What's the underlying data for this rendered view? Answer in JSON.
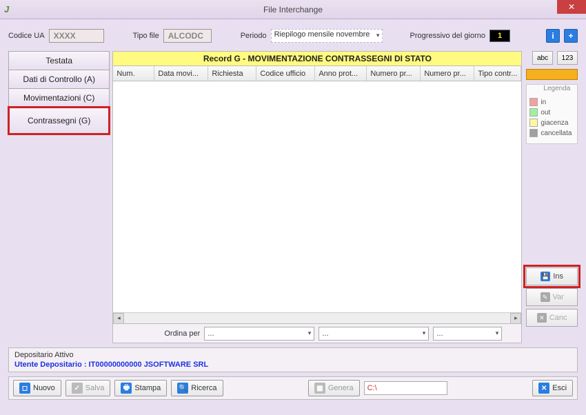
{
  "window": {
    "title": "File Interchange",
    "app_icon": "J"
  },
  "top": {
    "codice_ua_label": "Codice UA",
    "codice_ua_value": "XXXX",
    "tipo_file_label": "Tipo file",
    "tipo_file_value": "ALCODC",
    "periodo_label": "Periodo",
    "periodo_value": "Riepilogo mensile novembre",
    "progressivo_label": "Progressivo del giorno",
    "progressivo_value": "1"
  },
  "tabs": {
    "items": [
      {
        "label": "Testata"
      },
      {
        "label": "Dati di Controllo (A)"
      },
      {
        "label": "Movimentazioni (C)"
      },
      {
        "label": "Contrassegni (G)"
      }
    ]
  },
  "banner": "Record G - MOVIMENTAZIONE CONTRASSEGNI DI STATO",
  "columns": [
    "Num.",
    "Data movi...",
    "Richiesta",
    "Codice ufficio",
    "Anno prot...",
    "Numero pr...",
    "Numero pr...",
    "Tipo contr..."
  ],
  "sort": {
    "label": "Ordina per",
    "combo1": "...",
    "combo2": "...",
    "combo3": "..."
  },
  "rightpanel": {
    "abc": "abc",
    "num": "123",
    "legend_title": "Legenda",
    "legend": [
      {
        "label": "in",
        "color": "#f5a0a0"
      },
      {
        "label": "out",
        "color": "#a0f0a0"
      },
      {
        "label": "giacenza",
        "color": "#fff8a0"
      },
      {
        "label": "cancellata",
        "color": "#a0a0a0"
      }
    ],
    "ins": "Ins",
    "var": "Var",
    "canc": "Canc"
  },
  "footer": {
    "heading": "Depositario Attivo",
    "user": "Utente Depositario : IT00000000000  JSOFTWARE SRL"
  },
  "bottom": {
    "nuovo": "Nuovo",
    "salva": "Salva",
    "stampa": "Stampa",
    "ricerca": "Ricerca",
    "genera": "Genera",
    "path": "C:\\",
    "esci": "Esci"
  }
}
